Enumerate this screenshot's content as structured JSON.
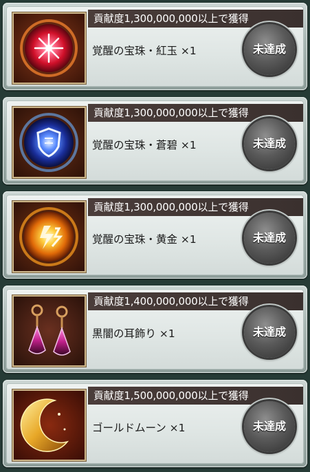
{
  "rewards": [
    {
      "condition": "貢献度1,300,000,000以上で獲得",
      "item_name": "覚醒の宝珠・紅玉 ×1",
      "status": "未達成",
      "icon": "red-orb-icon",
      "icon_colors": {
        "core": "#ffe9f3",
        "mid": "#ff3a5a",
        "outer": "#7a0a12",
        "bg": "#5a2614"
      }
    },
    {
      "condition": "貢献度1,300,000,000以上で獲得",
      "item_name": "覚醒の宝珠・蒼碧 ×1",
      "status": "未達成",
      "icon": "blue-shield-orb-icon",
      "icon_colors": {
        "core": "#e8f2ff",
        "mid": "#3a6cff",
        "outer": "#141e6e",
        "bg": "#4a2414"
      }
    },
    {
      "condition": "貢献度1,300,000,000以上で獲得",
      "item_name": "覚醒の宝珠・黄金 ×1",
      "status": "未達成",
      "icon": "gold-orb-icon",
      "icon_colors": {
        "core": "#fff7d0",
        "mid": "#ffb020",
        "outer": "#8a3a06",
        "bg": "#4a2614"
      }
    },
    {
      "condition": "貢献度1,400,000,000以上で獲得",
      "item_name": "黒闇の耳飾り ×1",
      "status": "未達成",
      "icon": "dark-earrings-icon",
      "icon_colors": {
        "core": "#ff6ad0",
        "mid": "#b0207a",
        "outer": "#3a0a26",
        "bg": "#3e1f14"
      }
    },
    {
      "condition": "貢献度1,500,000,000以上で獲得",
      "item_name": "ゴールドムーン ×1",
      "status": "未達成",
      "icon": "gold-moon-icon",
      "icon_colors": {
        "core": "#ffe890",
        "mid": "#e0a020",
        "outer": "#7a4006",
        "bg": "#4a1e10"
      }
    }
  ]
}
